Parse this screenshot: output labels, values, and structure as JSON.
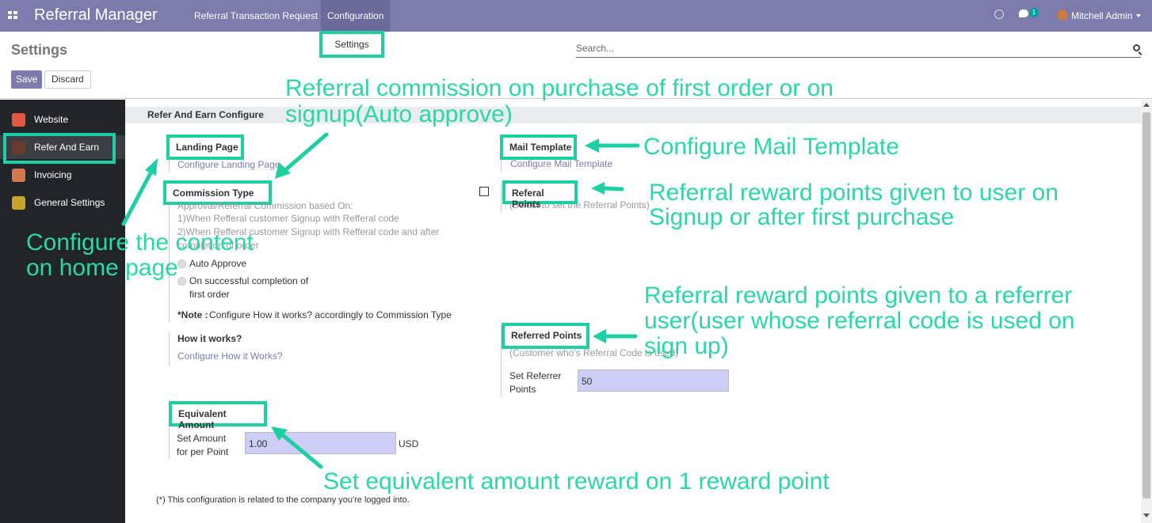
{
  "topbar": {
    "app_name": "Referral Manager",
    "menus": [
      "Referral Transaction Request",
      "Configuration"
    ],
    "badge_count": "1",
    "user": "Mitchell Admin",
    "brand_color": "#7c7bad"
  },
  "dropdown": {
    "item": "Settings"
  },
  "control_panel": {
    "title": "Settings",
    "save_label": "Save",
    "discard_label": "Discard",
    "search_placeholder": "Search..."
  },
  "sidebar": {
    "items": [
      {
        "label": "Website",
        "icon": "globe-icon"
      },
      {
        "label": "Refer And Earn",
        "icon": "refer-icon"
      },
      {
        "label": "Invoicing",
        "icon": "invoice-icon"
      },
      {
        "label": "General Settings",
        "icon": "gear-icon"
      }
    ]
  },
  "settings": {
    "section_title": "Refer And Earn Configure",
    "landing_page": {
      "title": "Landing Page",
      "link": "Configure Landing Page"
    },
    "mail_template": {
      "title": "Mail Template",
      "link": "Configure Mail Template"
    },
    "commission_type": {
      "title": "Commission Type",
      "desc_lines": [
        "Approval/Referral Commission based On:",
        "1)When Refferal customer Signup with Refferal code",
        "2)When Refferal customer Signup with Refferal code and after",
        "completion of order"
      ],
      "options": [
        "Auto Approve",
        "On successful completion of",
        "first order"
      ],
      "note_label": "*Note :",
      "note_text": "Configure How it works? accordingly to Commission Type"
    },
    "referal_points": {
      "title": "Referal Points",
      "desc": "(Select to set the Referral Points)"
    },
    "how_it_works": {
      "title": "How it works?",
      "link": "Configure How it Works?"
    },
    "referred_points": {
      "title": "Referred Points",
      "desc": "(Customer who's Referral Code is used)",
      "field_label_1": "Set Referrer",
      "field_label_2": "Points",
      "value": "50"
    },
    "equivalent_amount": {
      "title": "Equivalent Amount",
      "field_label_1": "Set Amount",
      "field_label_2": "for per Point",
      "value": "1.00",
      "currency": "USD"
    },
    "footer_note": "(*) This configuration is related to the company you're logged into."
  },
  "annotations": {
    "commission_1": "Referral commission on purchase of first order or on",
    "commission_2": "signup(Auto approve)",
    "mail": "Configure Mail Template",
    "reward_1": "Referral reward points given to user on",
    "reward_2": "Signup or after first purchase",
    "content_1": "Configure the content",
    "content_2": "on home page",
    "referrer_1": "Referral reward  points  given to a referrer",
    "referrer_2": "user(user whose referral code is used on",
    "referrer_3": "sign up)",
    "equivalent": "Set equivalent amount reward on 1 reward point",
    "accent_color": "#1fcfa4"
  }
}
